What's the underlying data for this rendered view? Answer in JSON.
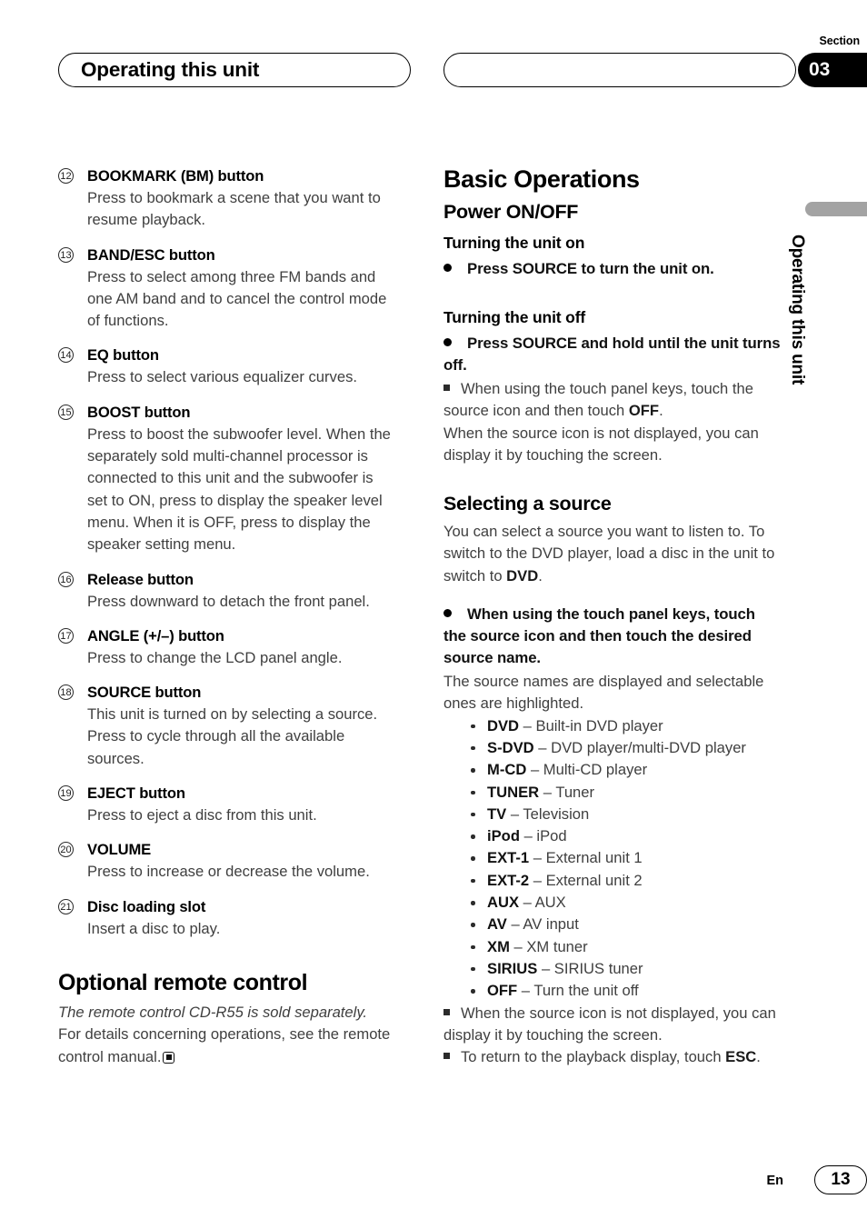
{
  "header": {
    "title": "Operating this unit",
    "section_label": "Section",
    "section_number": "03"
  },
  "side_tab": {
    "text": "Operating this unit"
  },
  "left_column": {
    "numbered_items": [
      {
        "number": "12",
        "title": "BOOKMARK (BM) button",
        "desc": "Press to bookmark a scene that you want to resume playback."
      },
      {
        "number": "13",
        "title": "BAND/ESC button",
        "desc": "Press to select among three FM bands and one AM band and to cancel the control mode of functions."
      },
      {
        "number": "14",
        "title": "EQ button",
        "desc": "Press to select various equalizer curves."
      },
      {
        "number": "15",
        "title": "BOOST button",
        "desc": "Press to boost the subwoofer level. When the separately sold multi-channel processor is connected to this unit and the subwoofer is set to ON, press to display the speaker level menu. When it is OFF, press to display the speaker setting menu."
      },
      {
        "number": "16",
        "title": "Release button",
        "desc": "Press downward to detach the front panel."
      },
      {
        "number": "17",
        "title": "ANGLE (+/–) button",
        "desc": "Press to change the LCD panel angle."
      },
      {
        "number": "18",
        "title": "SOURCE button",
        "desc": "This unit is turned on by selecting a source. Press to cycle through all the available sources."
      },
      {
        "number": "19",
        "title": "EJECT button",
        "desc": "Press to eject a disc from this unit."
      },
      {
        "number": "20",
        "title": "VOLUME",
        "desc": "Press to increase or decrease the volume."
      },
      {
        "number": "21",
        "title": "Disc loading slot",
        "desc": "Insert a disc to play."
      }
    ],
    "optional_remote": {
      "heading": "Optional remote control",
      "italic_line": "The remote control CD-R55 is sold separately.",
      "body": "For details concerning operations, see the remote control manual."
    }
  },
  "right_column": {
    "basic_operations_heading": "Basic Operations",
    "power_heading": "Power ON/OFF",
    "turning_on_heading": "Turning the unit on",
    "turning_on_bullet": "Press SOURCE to turn the unit on.",
    "turning_off_heading": "Turning the unit off",
    "turning_off_bullet": "Press SOURCE and hold until the unit turns off.",
    "turning_off_note_pre": "When using the touch panel keys, touch the source icon and then touch ",
    "turning_off_note_bold": "OFF",
    "turning_off_note_post": ".",
    "turning_off_note_line2": "When the source icon is not displayed, you can display it by touching the screen.",
    "selecting_heading": "Selecting a source",
    "selecting_intro_pre": "You can select a source you want to listen to. To switch to the DVD player, load a disc in the unit to switch to ",
    "selecting_intro_bold": "DVD",
    "selecting_intro_post": ".",
    "selecting_bullet": "When using the touch panel keys, touch the source icon and then touch the desired source name.",
    "selecting_sub": "The source names are displayed and selectable ones are highlighted.",
    "sources": [
      {
        "name": "DVD",
        "desc": "Built-in DVD player"
      },
      {
        "name": "S-DVD",
        "desc": "DVD player/multi-DVD player"
      },
      {
        "name": "M-CD",
        "desc": "Multi-CD player"
      },
      {
        "name": "TUNER",
        "desc": "Tuner"
      },
      {
        "name": "TV",
        "desc": "Television"
      },
      {
        "name": "iPod",
        "desc": "iPod"
      },
      {
        "name": "EXT-1",
        "desc": "External unit 1"
      },
      {
        "name": "EXT-2",
        "desc": "External unit 2"
      },
      {
        "name": "AUX",
        "desc": "AUX"
      },
      {
        "name": "AV",
        "desc": "AV input"
      },
      {
        "name": "XM",
        "desc": "XM tuner"
      },
      {
        "name": "SIRIUS",
        "desc": "SIRIUS tuner"
      },
      {
        "name": "OFF",
        "desc": "Turn the unit off"
      }
    ],
    "note_source_icon": "When the source icon is not displayed, you can display it by touching the screen.",
    "note_return_pre": "To return to the playback display, touch ",
    "note_return_bold": "ESC",
    "note_return_post": "."
  },
  "footer": {
    "language": "En",
    "page_number": "13"
  },
  "colors": {
    "section_badge_bg": "#000000",
    "side_tab_bg": "#a3a3a3",
    "body_text": "#3f3f3f",
    "heading_text": "#000000"
  }
}
